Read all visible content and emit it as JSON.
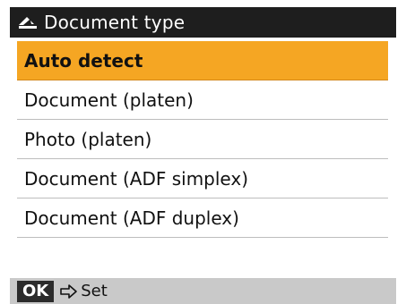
{
  "title_bar": {
    "icon": "scanner-icon",
    "title": "Document type"
  },
  "menu": {
    "selected_index": 0,
    "items": [
      {
        "label": "Auto detect"
      },
      {
        "label": "Document (platen)"
      },
      {
        "label": "Photo (platen)"
      },
      {
        "label": "Document (ADF simplex)"
      },
      {
        "label": "Document (ADF duplex)"
      }
    ]
  },
  "bottom_bar": {
    "ok_key": "OK",
    "arrow_icon": "arrow-right-icon",
    "set_label": "Set"
  },
  "colors": {
    "title_background": "#1e1e1e",
    "selection": "#f5a623",
    "bottom_bar_background": "#c9c9c9"
  }
}
